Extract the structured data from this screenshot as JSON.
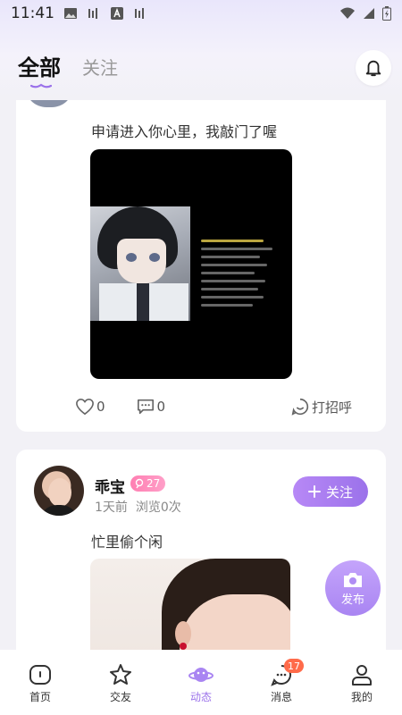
{
  "status": {
    "time": "11:41"
  },
  "tabs": {
    "all": "全部",
    "following": "关注"
  },
  "posts": [
    {
      "text": "申请进入你心里，我敲门了喔",
      "likes": "0",
      "comments": "0",
      "greet_label": "打招呼"
    },
    {
      "username": "乖宝",
      "badge": "27",
      "time_ago": "1天前",
      "views": "浏览0次",
      "follow_label": "关注",
      "text": "忙里偷个闲"
    }
  ],
  "fab": {
    "label": "发布"
  },
  "nav": {
    "items": [
      {
        "label": "首页",
        "icon": "home-icon"
      },
      {
        "label": "交友",
        "icon": "star-icon"
      },
      {
        "label": "动态",
        "icon": "planet-icon"
      },
      {
        "label": "消息",
        "icon": "message-icon",
        "badge": "17"
      },
      {
        "label": "我的",
        "icon": "user-icon"
      }
    ]
  },
  "colors": {
    "accent": "#9b72ea",
    "badge_pink": "#ff7fb2",
    "nav_badge": "#ff6b4a"
  }
}
